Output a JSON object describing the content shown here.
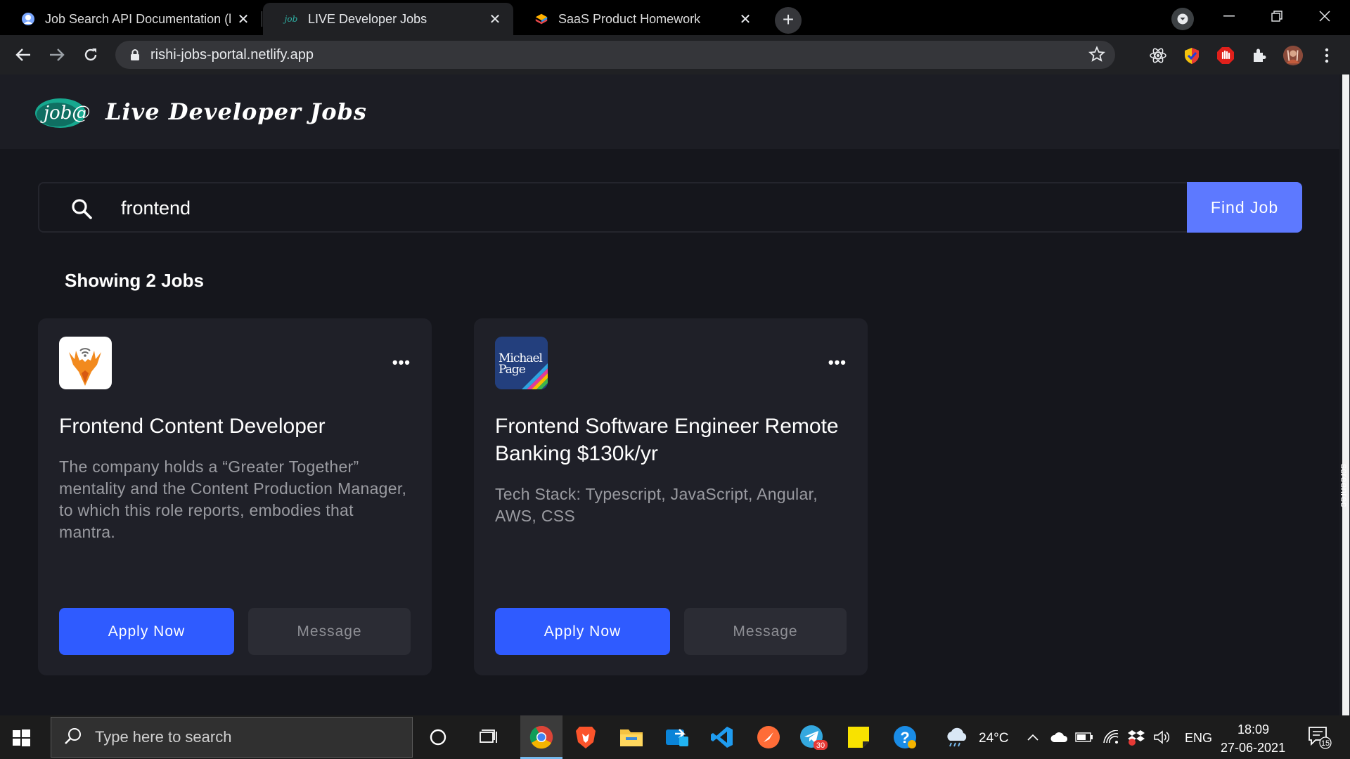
{
  "browser": {
    "tabs": [
      {
        "title": "Job Search API Documentation (l",
        "close": "✕"
      },
      {
        "title": "LIVE Developer Jobs",
        "close": "✕",
        "favicon": "job"
      },
      {
        "title": "SaaS Product Homework",
        "close": "✕"
      }
    ],
    "new_tab": "+",
    "url": "rishi-jobs-portal.netlify.app"
  },
  "site": {
    "logo_text": "job@",
    "brand": "Live Developer Jobs"
  },
  "search": {
    "value": "frontend",
    "button_label": "Find Job"
  },
  "results_label": "Showing 2 Jobs",
  "jobs": [
    {
      "title": "Frontend Content Developer",
      "description": "The company holds a “Greater Together” mentality and the Content Production Manager, to which this role reports, embodies that mantra.",
      "apply_label": "Apply Now",
      "message_label": "Message",
      "more": "•••"
    },
    {
      "title": "Frontend Software Engineer Remote Banking $130k/yr",
      "description": "Tech Stack: Typescript, JavaScript, Angular, AWS, CSS",
      "apply_label": "Apply Now",
      "message_label": "Message",
      "more": "•••",
      "logo_line1": "Michael",
      "logo_line2": "Page"
    }
  ],
  "taskbar": {
    "search_placeholder": "Type here to search",
    "weather": "24°C",
    "language": "ENG",
    "time": "18:09",
    "date": "27-06-2021",
    "notifications": "15",
    "telegram_badge": "30"
  },
  "screenrec": "screenrec",
  "colors": {
    "accent": "#5d79ff",
    "apply": "#2f5bff",
    "background": "#15161c",
    "card": "#1f2028"
  }
}
